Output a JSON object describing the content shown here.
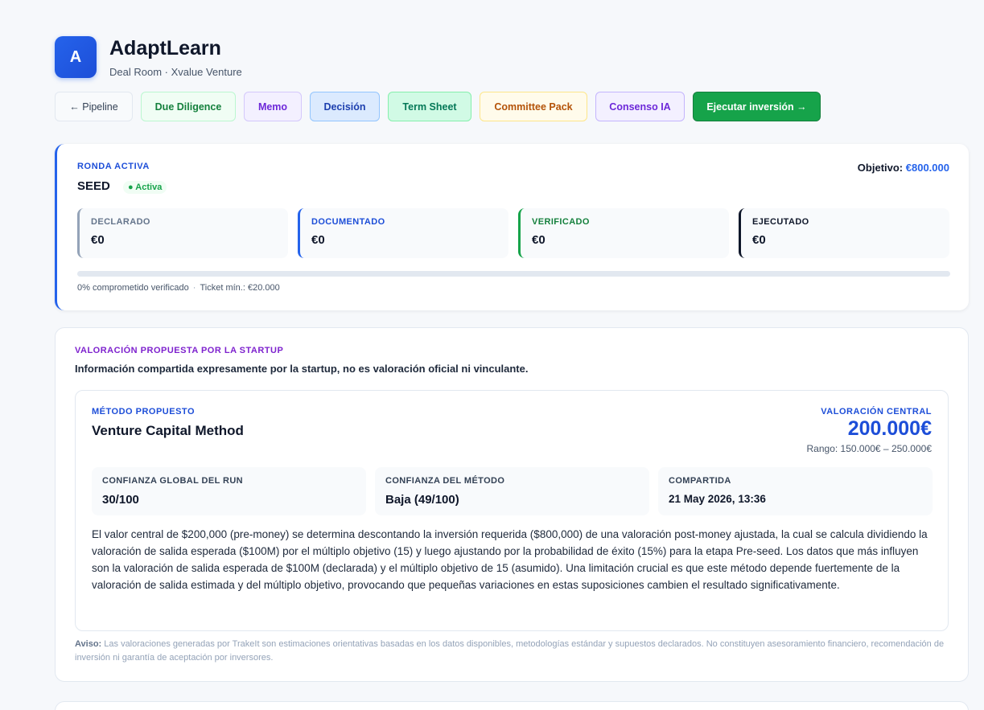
{
  "header": {
    "logo_letter": "A",
    "title": "AdaptLearn",
    "subtitle": "Deal Room · Xvalue Venture"
  },
  "nav": {
    "pipeline": "← Pipeline",
    "due_diligence": "Due Diligence",
    "memo": "Memo",
    "decision": "Decisión",
    "term_sheet": "Term Sheet",
    "committee_pack": "Committee Pack",
    "consenso_ia": "Consenso IA",
    "execute": "Ejecutar inversión →"
  },
  "round": {
    "label": "RONDA ACTIVA",
    "name": "SEED",
    "status": "● Activa",
    "objective_label": "Objetivo:",
    "objective_value": "€800.000",
    "stats": [
      {
        "label": "DECLARADO",
        "value": "€0"
      },
      {
        "label": "DOCUMENTADO",
        "value": "€0"
      },
      {
        "label": "VERIFICADO",
        "value": "€0"
      },
      {
        "label": "EJECUTADO",
        "value": "€0"
      }
    ],
    "progress_fraction": 0,
    "verified_text": "0% comprometido verificado",
    "separator": "·",
    "ticket_min": "Ticket mín.: €20.000"
  },
  "valuation": {
    "label": "VALORACIÓN PROPUESTA POR LA STARTUP",
    "subtitle": "Información compartida expresamente por la startup, no es valoración oficial ni vinculante.",
    "method_label": "MÉTODO PROPUESTO",
    "method_name": "Venture Capital Method",
    "central_label": "VALORACIÓN CENTRAL",
    "central_value": "200.000€",
    "range": "Rango: 150.000€ – 250.000€",
    "metrics": [
      {
        "label": "CONFIANZA GLOBAL DEL RUN",
        "value": "30/100"
      },
      {
        "label": "CONFIANZA DEL MÉTODO",
        "value": "Baja (49/100)"
      },
      {
        "label": "COMPARTIDA",
        "value": "21 May 2026, 13:36"
      }
    ],
    "description": "El valor central de $200,000 (pre-money) se determina descontando la inversión requerida ($800,000) de una valoración post-money ajustada, la cual se calcula dividiendo la valoración de salida esperada ($100M) por el múltiplo objetivo (15) y luego ajustando por la probabilidad de éxito (15%) para la etapa Pre-seed. Los datos que más influyen son la valoración de salida esperada de $100M (declarada) y el múltiplo objetivo de 15 (asumido). Una limitación crucial es que este método depende fuertemente de la valoración de salida estimada y del múltiplo objetivo, provocando que pequeñas variaciones en estas suposiciones cambien el resultado significativamente.",
    "disclaimer_label": "Aviso:",
    "disclaimer_text": " Las valoraciones generadas por TrakeIt son estimaciones orientativas basadas en los datos disponibles, metodologías estándar y supuestos declarados. No constituyen asesoramiento financiero, recomendación de inversión ni garantía de aceptación por inversores."
  }
}
